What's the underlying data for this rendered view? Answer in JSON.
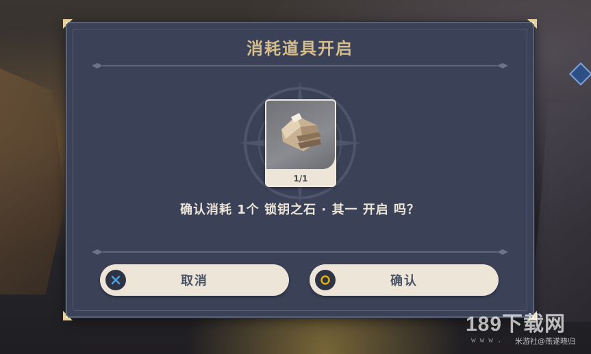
{
  "dialog": {
    "title": "消耗道具开启",
    "item": {
      "count": "1/1",
      "icon": "key-sigil-stone-icon"
    },
    "prompt": "确认消耗 1个 锁钥之石 · 其一 开启 吗？",
    "buttons": {
      "cancel_label": "取消",
      "cancel_icon": "cross-icon",
      "confirm_label": "确认",
      "confirm_icon": "circle-icon"
    }
  },
  "watermark": {
    "site": "189下载网",
    "url": "www.",
    "sub": "米游社@燕遂晓归"
  },
  "colors": {
    "dialog_bg": "#3b4258",
    "title": "#d6bd8c",
    "button_bg": "#ece5d8",
    "cancel_icon": "#4aa3df",
    "confirm_icon": "#e6b400"
  }
}
